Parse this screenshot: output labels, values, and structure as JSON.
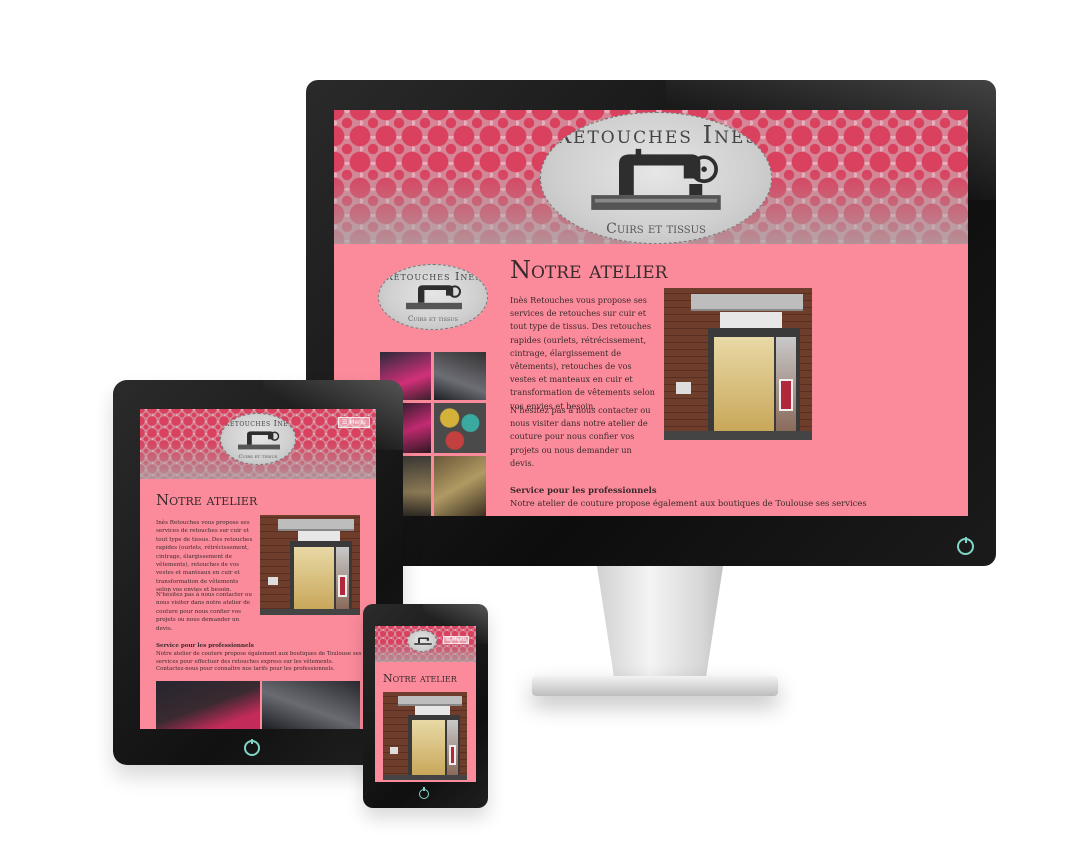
{
  "brand": {
    "logo_title": "Retouches Inès",
    "logo_subtitle": "Cuirs et tissus"
  },
  "page": {
    "title": "Notre atelier",
    "intro": "Inès Retouches vous propose ses services de retouches sur cuir et tout type de tissus. Des retouches rapides (ourlets, rétrécissement, cintrage, élargissement de vêtements), retouches de vos vestes et manteaux en cuir et transformation de vêtements selon vos envies et besoin.",
    "contact": "N'hésitez pas à nous contacter ou nous visiter dans notre atelier de couture pour nous confier vos projets ou nous demander un devis.",
    "pro_heading": "Service pour les professionnels",
    "pro_text_desktop": "Notre atelier de couture propose également aux boutiques de Toulouse ses services",
    "pro_text_tablet": "Notre atelier de couture propose également aux boutiques de Toulouse ses services pour effectuer des retouches express sur les vêtements. Contactez-nous pour connaître nos tarifs pour les professionnels."
  },
  "nav": {
    "menu_label": "Menu"
  },
  "colors": {
    "site_background": "#fb8b9b",
    "pattern_dot": "#d9415f",
    "power_led": "#7fd6c8"
  },
  "icons": {
    "power": "power-icon",
    "menu": "hamburger-icon"
  }
}
